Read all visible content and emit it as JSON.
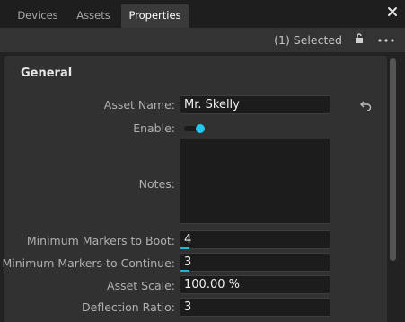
{
  "tabs": [
    {
      "label": "Devices"
    },
    {
      "label": "Assets"
    },
    {
      "label": "Properties",
      "active": true
    }
  ],
  "toolbar": {
    "selected_text": "(1) Selected"
  },
  "icons": {
    "close": "close-icon",
    "lock": "unlock-icon",
    "more": "more-horizontal-icon",
    "undo": "undo-icon"
  },
  "section": {
    "title": "General"
  },
  "fields": {
    "asset_name": {
      "label": "Asset Name:",
      "value": "Mr. Skelly"
    },
    "enable": {
      "label": "Enable:",
      "on": true
    },
    "notes": {
      "label": "Notes:",
      "value": ""
    },
    "min_markers_boot": {
      "label": "Minimum Markers to Boot:",
      "value": "4"
    },
    "min_markers_continue": {
      "label": "Minimum Markers to Continue:",
      "value": "3"
    },
    "asset_scale": {
      "label": "Asset Scale:",
      "value": "100.00 %"
    },
    "deflection_ratio": {
      "label": "Deflection Ratio:",
      "value": "3"
    }
  },
  "colors": {
    "accent": "#21c8ef",
    "background": "#222222",
    "panel": "#313131"
  }
}
